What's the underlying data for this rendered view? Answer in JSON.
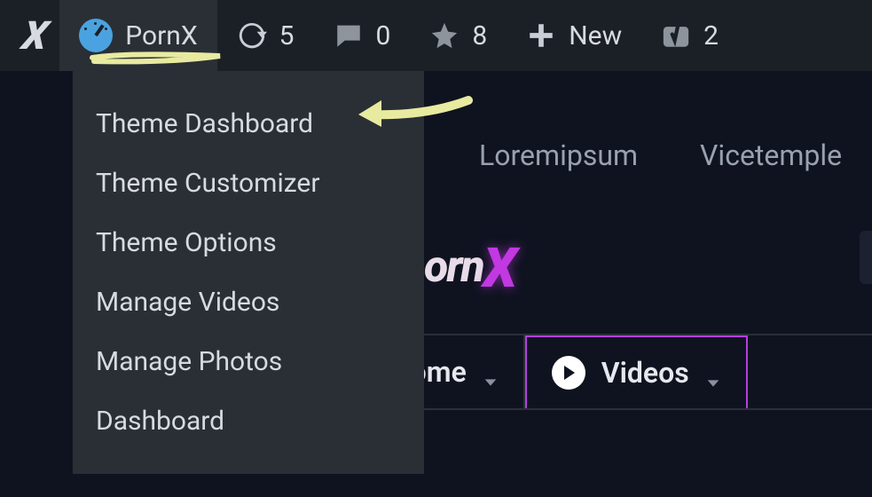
{
  "adminbar": {
    "site_name": "PornX",
    "updates": "5",
    "comments": "0",
    "starred": "8",
    "new_label": "New",
    "yoast": "2"
  },
  "submenu": {
    "items": [
      "Theme Dashboard",
      "Theme Customizer",
      "Theme Options",
      "Manage Videos",
      "Manage Photos",
      "Dashboard"
    ]
  },
  "hero_nav": {
    "links": [
      "Loremipsum",
      "Vicetemple"
    ]
  },
  "logo": {
    "part1": "orn",
    "part2": "X"
  },
  "tabs": {
    "home": "Home",
    "videos": "Videos"
  }
}
